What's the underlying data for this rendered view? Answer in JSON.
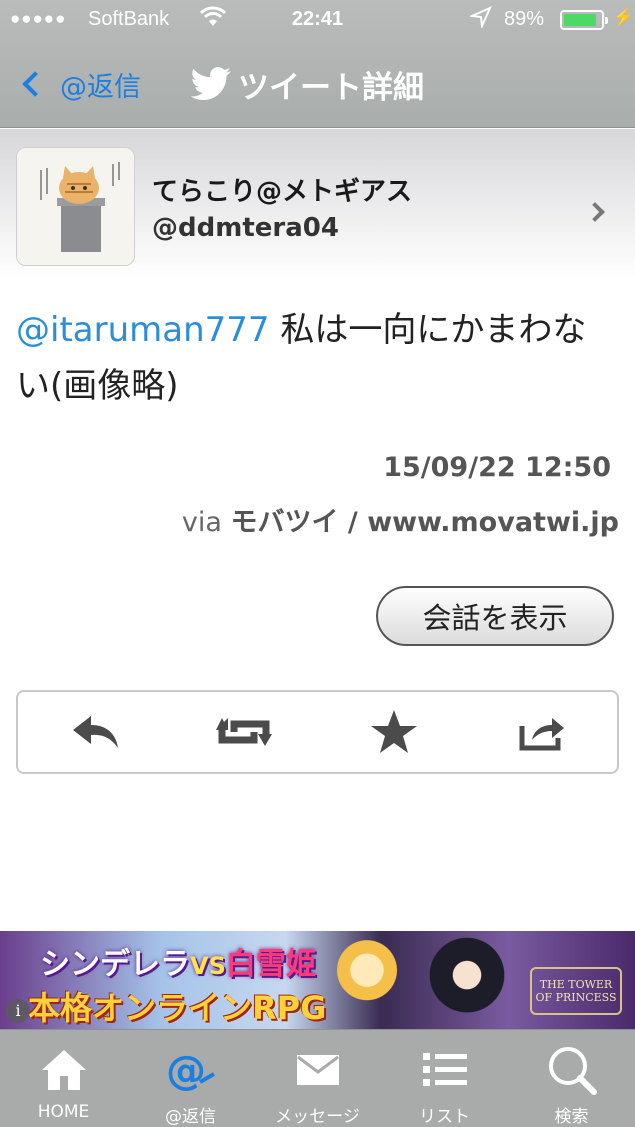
{
  "status_bar": {
    "signal": "●●●●●",
    "carrier": "SoftBank",
    "time": "22:41",
    "battery_percent": "89%",
    "battery_level": 0.89,
    "battery_color": "#4cd964"
  },
  "nav": {
    "back_label": "@返信",
    "title": "ツイート詳細",
    "accent": "#1b7fe0"
  },
  "profile": {
    "name": "てらこり@メトギアス",
    "handle": "@ddmtera04"
  },
  "tweet": {
    "mention": "@itaruman777",
    "text": " 私は一向にかまわない(画像略)",
    "mention_color": "#2a8fd8",
    "date": "15/09/22 12:50",
    "via_prefix": "via ",
    "client": "モバツイ / www.movatwi.jp"
  },
  "conversation_button": "会話を表示",
  "actions": {
    "icons": [
      "reply-icon",
      "retweet-icon",
      "favorite-star-icon",
      "share-icon"
    ]
  },
  "ad": {
    "line1_a": "シンデレラ",
    "line1_vs": "VS",
    "line1_b": "白雪姫",
    "line2": "本格オンラインRPG",
    "logo": "THE TOWER OF PRINCESS"
  },
  "tabbar": {
    "tabs": [
      {
        "label": "HOME",
        "icon": "home-icon"
      },
      {
        "label": "@返信",
        "icon": "at-reply-icon",
        "active": true
      },
      {
        "label": "メッセージ",
        "icon": "envelope-icon"
      },
      {
        "label": "リスト",
        "icon": "list-icon"
      },
      {
        "label": "検索",
        "icon": "search-icon"
      }
    ]
  }
}
